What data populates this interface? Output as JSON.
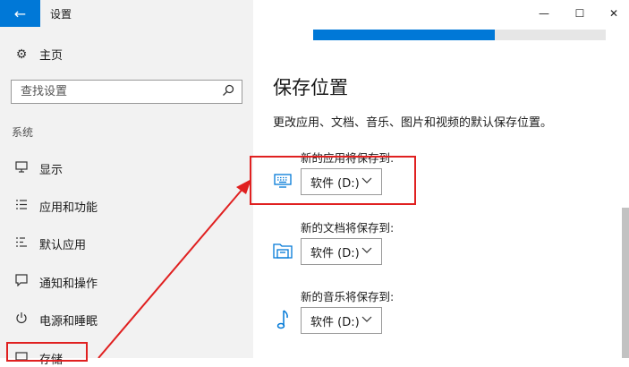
{
  "window": {
    "title": "设置",
    "back_glyph": "←",
    "minimize_glyph": "—",
    "maximize_glyph": "☐",
    "close_glyph": "✕"
  },
  "sidebar": {
    "home": {
      "label": "主页",
      "icon": "gear-icon"
    },
    "search": {
      "placeholder": "查找设置",
      "icon": "search-icon"
    },
    "section_label": "系统",
    "items": [
      {
        "label": "显示",
        "icon": "display-icon"
      },
      {
        "label": "应用和功能",
        "icon": "apps-list-icon"
      },
      {
        "label": "默认应用",
        "icon": "default-apps-icon"
      },
      {
        "label": "通知和操作",
        "icon": "notification-icon"
      },
      {
        "label": "电源和睡眠",
        "icon": "power-icon"
      },
      {
        "label": "存储",
        "icon": "storage-icon",
        "active": true
      }
    ]
  },
  "main": {
    "usage_progress": 0.62,
    "title": "保存位置",
    "description": "更改应用、文档、音乐、图片和视频的默认保存位置。",
    "settings": [
      {
        "label": "新的应用将保存到:",
        "value": "软件 (D:)",
        "icon": "apps-monitor-icon"
      },
      {
        "label": "新的文档将保存到:",
        "value": "软件 (D:)",
        "icon": "documents-folder-icon"
      },
      {
        "label": "新的音乐将保存到:",
        "value": "软件 (D:)",
        "icon": "music-note-icon"
      }
    ]
  },
  "colors": {
    "accent": "#0078d7",
    "annotation": "#e02020",
    "sidebar_bg": "#f2f2f2"
  }
}
